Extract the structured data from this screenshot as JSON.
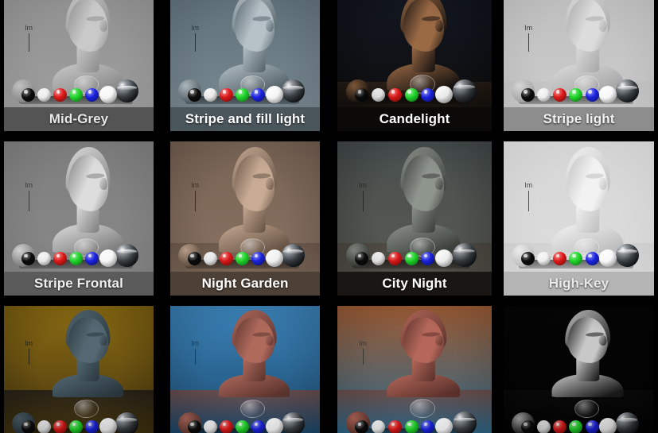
{
  "gallery": {
    "columns": 4,
    "rows": 3,
    "background_color": "#000000",
    "tiles": [
      {
        "label": "Mid-Grey",
        "label_bar_color": "#545454",
        "label_text_color": "#e8e8e8",
        "backdrop_top": "#8f8f8f",
        "backdrop_bottom": "#a2a2a2",
        "floor_color": "#9b9b9b",
        "bust_color": "#c9c9c9",
        "bust_shadow": "#8e8e8e",
        "marker_label": "lm",
        "marker_color": "#3a3a3a",
        "vignette": "rgba(0,0,0,0.10)",
        "cut_top": true,
        "cut_bottom": false
      },
      {
        "label": "Stripe and fill light",
        "label_bar_color": "#4b565c",
        "label_text_color": "#ffffff",
        "backdrop_top": "#5d6e78",
        "backdrop_bottom": "#7d8d95",
        "floor_color": "#73838c",
        "bust_color": "#b6c2c8",
        "bust_shadow": "#59666d",
        "marker_label": "lm",
        "marker_color": "#2b3338",
        "vignette": "rgba(0,0,0,0.14)",
        "cut_top": true,
        "cut_bottom": false
      },
      {
        "label": "Candelight",
        "label_bar_color": "#0b0a09",
        "label_text_color": "#ffffff",
        "backdrop_top": "#121722",
        "backdrop_bottom": "#0e0d0c",
        "floor_color": "#2a1f16",
        "bust_color": "#9a6a45",
        "bust_shadow": "#1a1411",
        "marker_label": "",
        "marker_color": "#3a2a1c",
        "vignette": "rgba(0,0,0,0.45)",
        "cut_top": true,
        "cut_bottom": false
      },
      {
        "label": "Stripe light",
        "label_bar_color": "#8d8d8d",
        "label_text_color": "#f2f2f2",
        "backdrop_top": "#bdbdbd",
        "backdrop_bottom": "#cfcfcf",
        "floor_color": "#c4c4c4",
        "bust_color": "#dcdcdc",
        "bust_shadow": "#a9a9a9",
        "marker_label": "lm",
        "marker_color": "#3d3d3d",
        "vignette": "rgba(0,0,0,0.08)",
        "cut_top": true,
        "cut_bottom": false
      },
      {
        "label": "Stripe Frontal",
        "label_bar_color": "#5b5b5b",
        "label_text_color": "#f0f0f0",
        "backdrop_top": "#7e7e7e",
        "backdrop_bottom": "#8a8a8a",
        "floor_color": "#848484",
        "bust_color": "#dddddd",
        "bust_shadow": "#828282",
        "marker_label": "lm",
        "marker_color": "#3a3a3a",
        "vignette": "rgba(0,0,0,0.12)",
        "cut_top": false,
        "cut_bottom": false
      },
      {
        "label": "Night Garden",
        "label_bar_color": "#4d4036",
        "label_text_color": "#ffffff",
        "backdrop_top": "#776354",
        "backdrop_bottom": "#8b7464",
        "floor_color": "#6d5a4c",
        "bust_color": "#c7ab94",
        "bust_shadow": "#6a5647",
        "marker_label": "lm",
        "marker_color": "#3b3026",
        "vignette": "rgba(0,0,0,0.22)",
        "cut_top": false,
        "cut_bottom": false
      },
      {
        "label": "City Night",
        "label_bar_color": "#191613",
        "label_text_color": "#ffffff",
        "backdrop_top": "#48504f",
        "backdrop_bottom": "#5b5a52",
        "floor_color": "#4e4a42",
        "bust_color": "#8e958d",
        "bust_shadow": "#3d423d",
        "marker_label": "lm",
        "marker_color": "#2a2c29",
        "vignette": "rgba(0,0,0,0.30)",
        "cut_top": false,
        "cut_bottom": false
      },
      {
        "label": "High-Key",
        "label_bar_color": "#b4b4b4",
        "label_text_color": "#eaeaea",
        "backdrop_top": "#d6d6d6",
        "backdrop_bottom": "#dedede",
        "floor_color": "#d2d2d2",
        "bust_color": "#f2f2f2",
        "bust_shadow": "#c0c0c0",
        "marker_label": "lm",
        "marker_color": "#4a4a4a",
        "vignette": "rgba(0,0,0,0.05)",
        "cut_top": false,
        "cut_bottom": false
      },
      {
        "label": "",
        "label_bar_color": "",
        "label_text_color": "",
        "backdrop_top": "#8a6a12",
        "backdrop_bottom": "#4a3a10",
        "floor_color": "#262018",
        "bust_color": "#536872",
        "bust_shadow": "#2c3940",
        "marker_label": "lm",
        "marker_color": "#2b2510",
        "vignette": "rgba(0,0,0,0.32)",
        "cut_top": false,
        "cut_bottom": true
      },
      {
        "label": "",
        "label_bar_color": "",
        "label_text_color": "",
        "backdrop_top": "#3b82b8",
        "backdrop_bottom": "#1d4d72",
        "floor_color": "#6b4a48",
        "bust_color": "#b06a5c",
        "bust_shadow": "#5d352f",
        "marker_label": "lm",
        "marker_color": "#1f3c52",
        "vignette": "rgba(0,0,0,0.22)",
        "cut_top": false,
        "cut_bottom": true
      },
      {
        "label": "",
        "label_bar_color": "",
        "label_text_color": "",
        "backdrop_top": "#9a5a33",
        "backdrop_bottom": "#2f6a8c",
        "floor_color": "#6a4a46",
        "bust_color": "#b5685a",
        "bust_shadow": "#5c322c",
        "marker_label": "lm",
        "marker_color": "#3a3a3a",
        "vignette": "rgba(0,0,0,0.20)",
        "cut_top": false,
        "cut_bottom": true
      },
      {
        "label": "",
        "label_bar_color": "",
        "label_text_color": "",
        "backdrop_top": "#050505",
        "backdrop_bottom": "#020202",
        "floor_color": "#0a0a0a",
        "bust_color": "#c8c8c8",
        "bust_shadow": "#1a1a1a",
        "marker_label": "",
        "marker_color": "#2a2a2a",
        "vignette": "rgba(0,0,0,0.40)",
        "cut_top": false,
        "cut_bottom": true
      }
    ],
    "sphere_row": {
      "description": "calibration spheres on a plinth",
      "colors": [
        {
          "name": "black-sphere",
          "hex": "#0c0c0c"
        },
        {
          "name": "white-sphere",
          "hex": "#f2f2f2"
        },
        {
          "name": "red-sphere",
          "hex": "#e01818"
        },
        {
          "name": "green-sphere",
          "hex": "#1fd62a"
        },
        {
          "name": "blue-sphere",
          "hex": "#1a22e0"
        },
        {
          "name": "white-large-sphere",
          "hex": "#fbfbfb"
        }
      ],
      "grey_ball": {
        "name": "grey-diffuse-sphere",
        "hex": "#9a9a9a"
      },
      "chrome_ball": {
        "name": "chrome-mirror-sphere",
        "hex": "#6e7378"
      }
    }
  }
}
